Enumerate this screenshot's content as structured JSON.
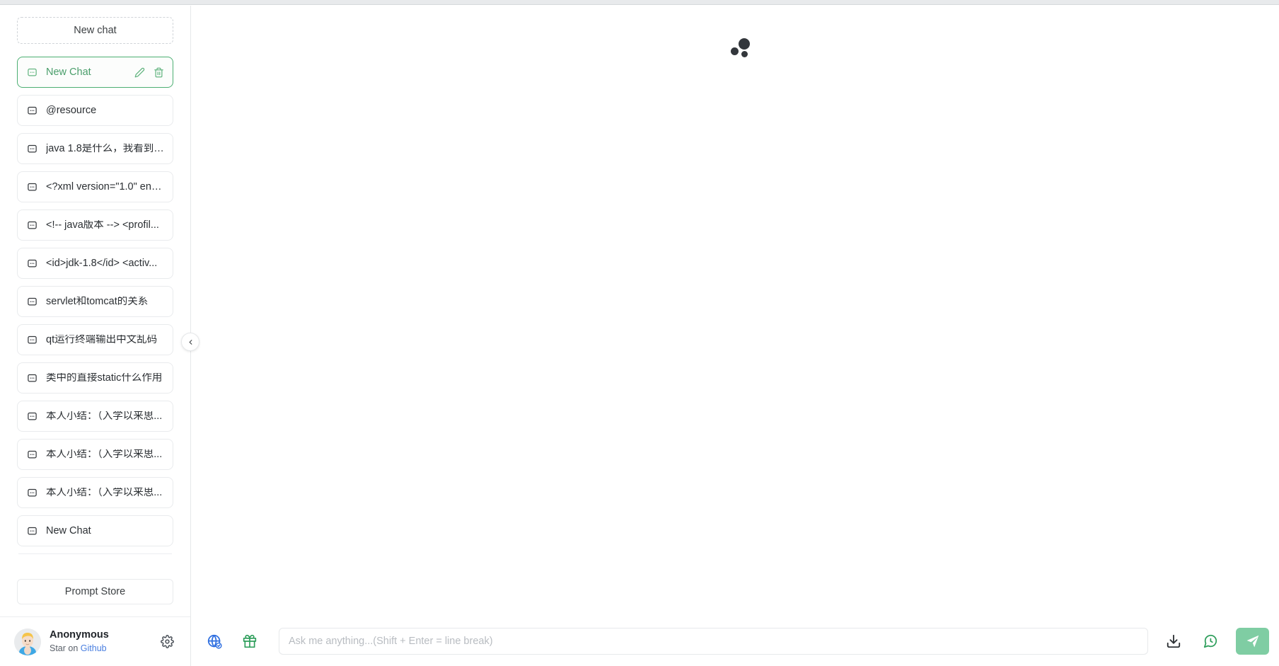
{
  "sidebar": {
    "new_chat_button": "New chat",
    "chats": [
      {
        "label": "New Chat",
        "selected": true,
        "icon": "message-square-icon"
      },
      {
        "label": "@resource",
        "selected": false,
        "icon": "message-square-icon"
      },
      {
        "label": "java 1.8是什么，我看到我...",
        "selected": false,
        "icon": "message-square-icon"
      },
      {
        "label": "<?xml version=\"1.0\" enc...",
        "selected": false,
        "icon": "message-square-icon"
      },
      {
        "label": "<!-- java版本 --> <profil...",
        "selected": false,
        "icon": "message-square-icon"
      },
      {
        "label": "<id>jdk-1.8</id> <activ...",
        "selected": false,
        "icon": "message-square-icon"
      },
      {
        "label": "servlet和tomcat的关系",
        "selected": false,
        "icon": "message-square-icon"
      },
      {
        "label": "qt运行终端输出中文乱码",
        "selected": false,
        "icon": "message-square-icon"
      },
      {
        "label": "类中的直接static什么作用",
        "selected": false,
        "icon": "message-square-icon"
      },
      {
        "label": "本人小结：（入学以来思...",
        "selected": false,
        "icon": "message-square-icon"
      },
      {
        "label": "本人小结：（入学以来思...",
        "selected": false,
        "icon": "message-square-icon"
      },
      {
        "label": "本人小结：（入学以来思...",
        "selected": false,
        "icon": "message-square-icon"
      },
      {
        "label": "New Chat",
        "selected": false,
        "icon": "message-square-icon"
      }
    ],
    "item_actions": {
      "edit": "edit-pencil-icon",
      "delete": "trash-icon"
    },
    "prompt_store_button": "Prompt Store",
    "user": {
      "name": "Anonymous",
      "subtitle_prefix": "Star on ",
      "subtitle_link": "Github",
      "settings_icon": "gear-icon",
      "avatar": "user-avatar"
    },
    "collapse_icon": "chevron-left-icon"
  },
  "main": {
    "brand_logo": "three-dots-logo"
  },
  "composer": {
    "globe_icon": "globe-check-icon",
    "gift_icon": "gift-icon",
    "placeholder": "Ask me anything...(Shift + Enter = line break)",
    "value": "",
    "download_icon": "download-icon",
    "history_icon": "clock-history-icon",
    "send_icon": "send-paper-plane-icon"
  },
  "colors": {
    "accent_green": "#4caf72",
    "send_button": "#7fcda3",
    "link_blue": "#4a7fe0",
    "globe_blue": "#2f6fe0",
    "gift_green": "#2e9e5b",
    "logo_dark": "#33373c"
  }
}
